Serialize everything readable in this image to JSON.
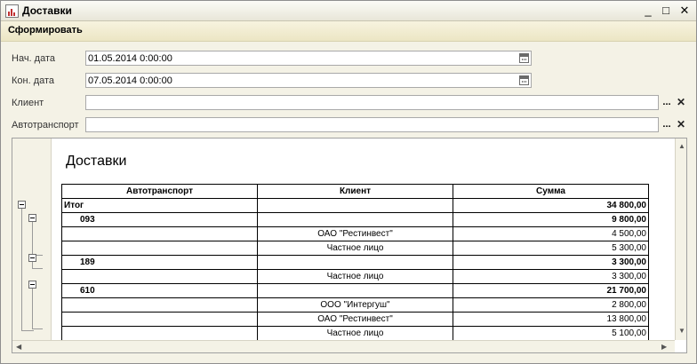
{
  "window": {
    "title": "Доставки"
  },
  "toolbar": {
    "generate_label": "Сформировать"
  },
  "form": {
    "start_date": {
      "label": "Нач. дата",
      "value": "01.05.2014  0:00:00"
    },
    "end_date": {
      "label": "Кон. дата",
      "value": "07.05.2014  0:00:00"
    },
    "client": {
      "label": "Клиент",
      "value": ""
    },
    "vehicle": {
      "label": "Автотранспорт",
      "value": ""
    },
    "select_glyph": "...",
    "clear_glyph": "✕"
  },
  "report": {
    "title": "Доставки",
    "columns": [
      "Автотранспорт",
      "Клиент",
      "Сумма"
    ],
    "rows": [
      {
        "vehicle": "Итог",
        "client": "",
        "sum": "34 800,00",
        "level": "total"
      },
      {
        "vehicle": "093",
        "client": "",
        "sum": "9 800,00",
        "level": "group"
      },
      {
        "vehicle": "",
        "client": "ОАО \"Рестинвест\"",
        "sum": "4 500,00",
        "level": "detail"
      },
      {
        "vehicle": "",
        "client": "Частное лицо",
        "sum": "5 300,00",
        "level": "detail"
      },
      {
        "vehicle": "189",
        "client": "",
        "sum": "3 300,00",
        "level": "group"
      },
      {
        "vehicle": "",
        "client": "Частное лицо",
        "sum": "3 300,00",
        "level": "detail"
      },
      {
        "vehicle": "610",
        "client": "",
        "sum": "21 700,00",
        "level": "group"
      },
      {
        "vehicle": "",
        "client": "ООО \"Интергуш\"",
        "sum": "2 800,00",
        "level": "detail"
      },
      {
        "vehicle": "",
        "client": "ОАО \"Рестинвест\"",
        "sum": "13 800,00",
        "level": "detail"
      },
      {
        "vehicle": "",
        "client": "Частное лицо",
        "sum": "5 100,00",
        "level": "detail"
      }
    ]
  },
  "icons": {
    "calendar": "calendar-icon",
    "minimize": "minimize-icon",
    "maximize": "maximize-icon",
    "close": "close-icon"
  }
}
